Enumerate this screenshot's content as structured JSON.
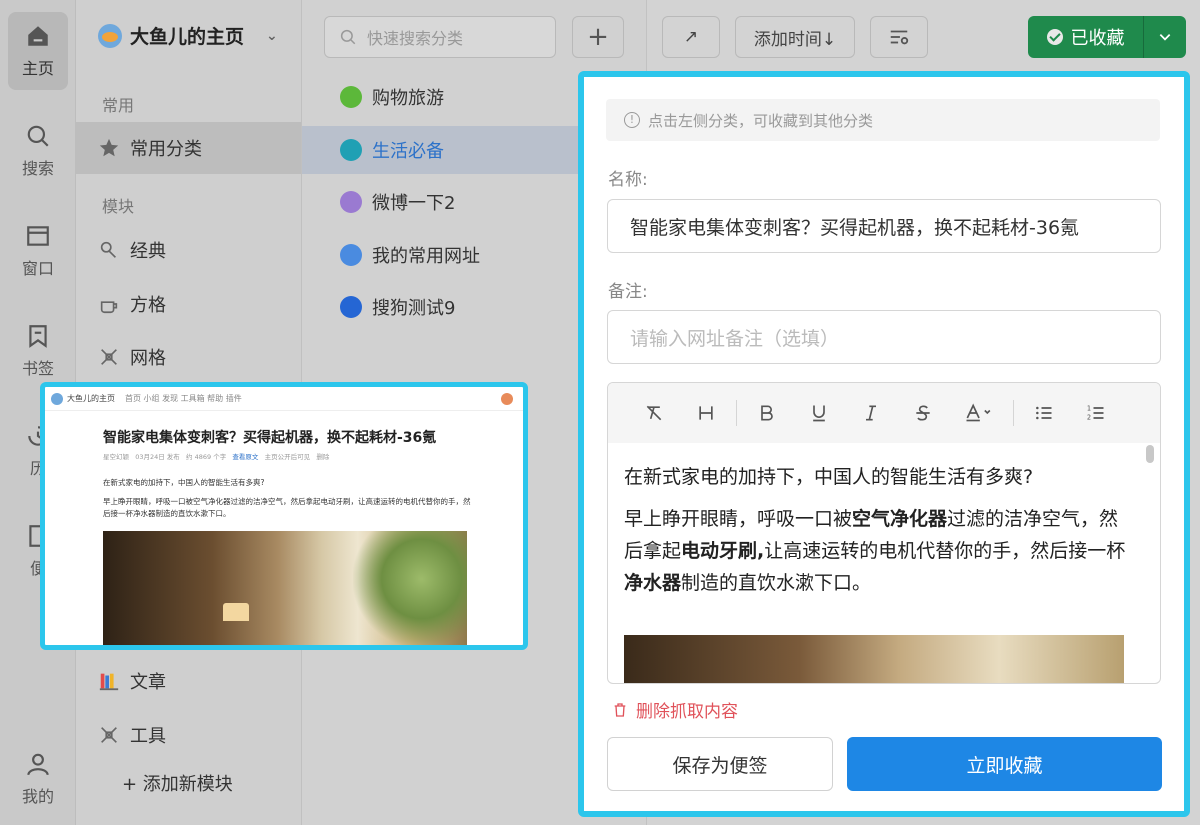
{
  "rail": [
    {
      "label": "主页",
      "icon": "home-icon",
      "active": true
    },
    {
      "label": "搜索",
      "icon": "search-icon"
    },
    {
      "label": "窗口",
      "icon": "window-icon"
    },
    {
      "label": "书签",
      "icon": "bookmark-icon"
    },
    {
      "label": "历",
      "icon": "history-icon"
    },
    {
      "label": "便",
      "icon": "note-icon"
    },
    {
      "label": "我的",
      "icon": "user-icon"
    }
  ],
  "modules": {
    "home_title": "大鱼儿的主页",
    "section_common": "常用",
    "common_item": "常用分类",
    "section_modules": "模块",
    "items": [
      "经典",
      "方格",
      "网格",
      "文章",
      "工具"
    ],
    "add_module": "+ 添加新模块"
  },
  "categories": {
    "search_placeholder": "快速搜索分类",
    "add_label": "+",
    "items": [
      {
        "label": "购物旅游",
        "color": "#5cb83a"
      },
      {
        "label": "生活必备",
        "color": "#1fa0b4",
        "active": true
      },
      {
        "label": "微博一下2",
        "color": "#9a7ad1"
      },
      {
        "label": "我的常用网址",
        "color": "#4a8be0"
      },
      {
        "label": "搜狗测试9",
        "color": "#2566d4"
      }
    ]
  },
  "toolbar": {
    "open_icon": "↗",
    "sort_label": "添加时间↓",
    "collected_label": "已收藏"
  },
  "dialog": {
    "hint": "点击左侧分类，可收藏到其他分类",
    "name_label": "名称:",
    "name_value": "智能家电集体变刺客？买得起机器，换不起耗材-36氪",
    "note_label": "备注:",
    "note_placeholder": "请输入网址备注（选填）",
    "editor_p1": "在新式家电的加持下，中国人的智能生活有多爽?",
    "editor_p2_a": "早上睁开眼睛，呼吸一口被",
    "editor_p2_b": "空气净化器",
    "editor_p2_c": "过滤的洁净空气，然后拿起",
    "editor_p2_d": "电动牙刷,",
    "editor_p2_e": "让高速运转的电机代替你的手，然后接一杯",
    "editor_p2_f": "净水器",
    "editor_p2_g": "制造的直饮水漱下口。",
    "delete_label": "删除抓取内容",
    "btn_note": "保存为便签",
    "btn_save": "立即收藏"
  },
  "preview": {
    "site": "大鱼儿的主页",
    "nav": "首页  小组  发现  工具箱  帮助  插件",
    "title": "智能家电集体变刺客？买得起机器，换不起耗材-36氪",
    "meta_a": "星空幻颖",
    "meta_b": "03月24日 发布",
    "meta_c": "约 4869 个字",
    "meta_d": "查看原文",
    "meta_e": "主页公开后可见",
    "meta_f": "删除",
    "p1": "在新式家电的加持下，中国人的智能生活有多爽?",
    "p2": "早上睁开眼睛，呼吸一口被空气净化器过滤的洁净空气，然后拿起电动牙刷，让高速运转的电机代替你的手，然后接一杯净水器制造的直饮水漱下口。"
  },
  "colors": {
    "accent": "#2cc6ec",
    "primary": "#1e87e5",
    "success": "#1f8a4c",
    "danger": "#e0525a"
  }
}
